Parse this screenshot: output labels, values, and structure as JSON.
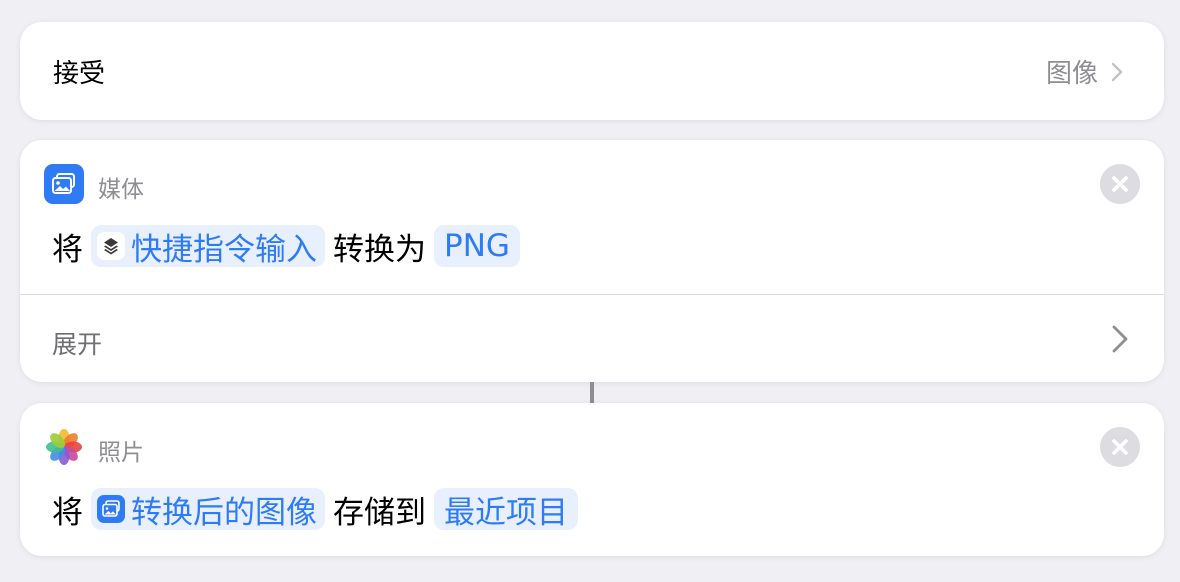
{
  "accept": {
    "label": "接受",
    "value": "图像"
  },
  "media_action": {
    "app_name": "媒体",
    "app_icon": "media-photo-icon",
    "verb": "将",
    "input_token": "快捷指令输入",
    "input_token_icon": "shortcuts-layers-icon",
    "middle": "转换为",
    "format_token": "PNG",
    "expand_label": "展开"
  },
  "photos_action": {
    "app_name": "照片",
    "app_icon": "photos-flower-icon",
    "verb": "将",
    "input_token": "转换后的图像",
    "input_token_icon": "image-icon",
    "middle": "存储到",
    "album_token": "最近项目"
  },
  "colors": {
    "background": "#efeff4",
    "accent": "#2f7bf5",
    "token_background": "#e8f0fd",
    "secondary_text": "#8e8e93"
  }
}
